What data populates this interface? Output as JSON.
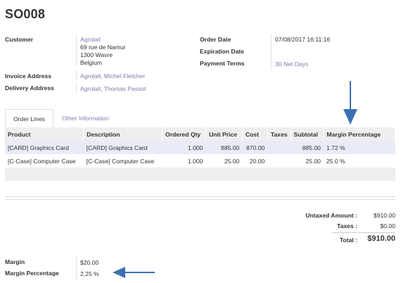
{
  "order": {
    "title": "SO008",
    "customer_label": "Customer",
    "customer_name": "Agrolait",
    "customer_addr1": "69 rue de Namur",
    "customer_addr2": "1300 Wavre",
    "customer_addr3": "Belgium",
    "invoice_label": "Invoice Address",
    "invoice_value": "Agrolait, Michel Fletcher",
    "delivery_label": "Delivery Address",
    "delivery_value": "Agrolait, Thomas Passot",
    "order_date_label": "Order Date",
    "order_date_value": "07/08/2017 16:11:16",
    "expiration_label": "Expiration Date",
    "payment_terms_label": "Payment Terms",
    "payment_terms_value": "30 Net Days"
  },
  "tabs": [
    {
      "label": "Order Lines",
      "active": true
    },
    {
      "label": "Other Information",
      "active": false
    }
  ],
  "lines": {
    "headers": [
      "Product",
      "Description",
      "Ordered Qty",
      "Unit Price",
      "Cost",
      "Taxes",
      "Subtotal",
      "Margin Percentage"
    ],
    "rows": [
      [
        "[CARD] Graphics Card",
        "[CARD] Graphics Card",
        "1.000",
        "885.00",
        "870.00",
        "",
        "885.00",
        "1.72 %"
      ],
      [
        "[C-Case] Computer Case",
        "[C-Case] Computer Case",
        "1.000",
        "25.00",
        "20.00",
        "",
        "25.00",
        "25.0 %"
      ]
    ]
  },
  "totals": {
    "untaxed_label": "Untaxed Amount :",
    "untaxed_value": "$910.00",
    "taxes_label": "Taxes :",
    "taxes_value": "$0.00",
    "total_label": "Total :",
    "total_value": "$910.00"
  },
  "margin": {
    "margin_label": "Margin",
    "margin_value": "$20.00",
    "pct_label": "Margin Percentage",
    "pct_value": "2.25 %"
  },
  "colors": {
    "link": "#7c7bad",
    "arrow": "#3d70b2",
    "row_highlight": "#e9ecf6"
  }
}
